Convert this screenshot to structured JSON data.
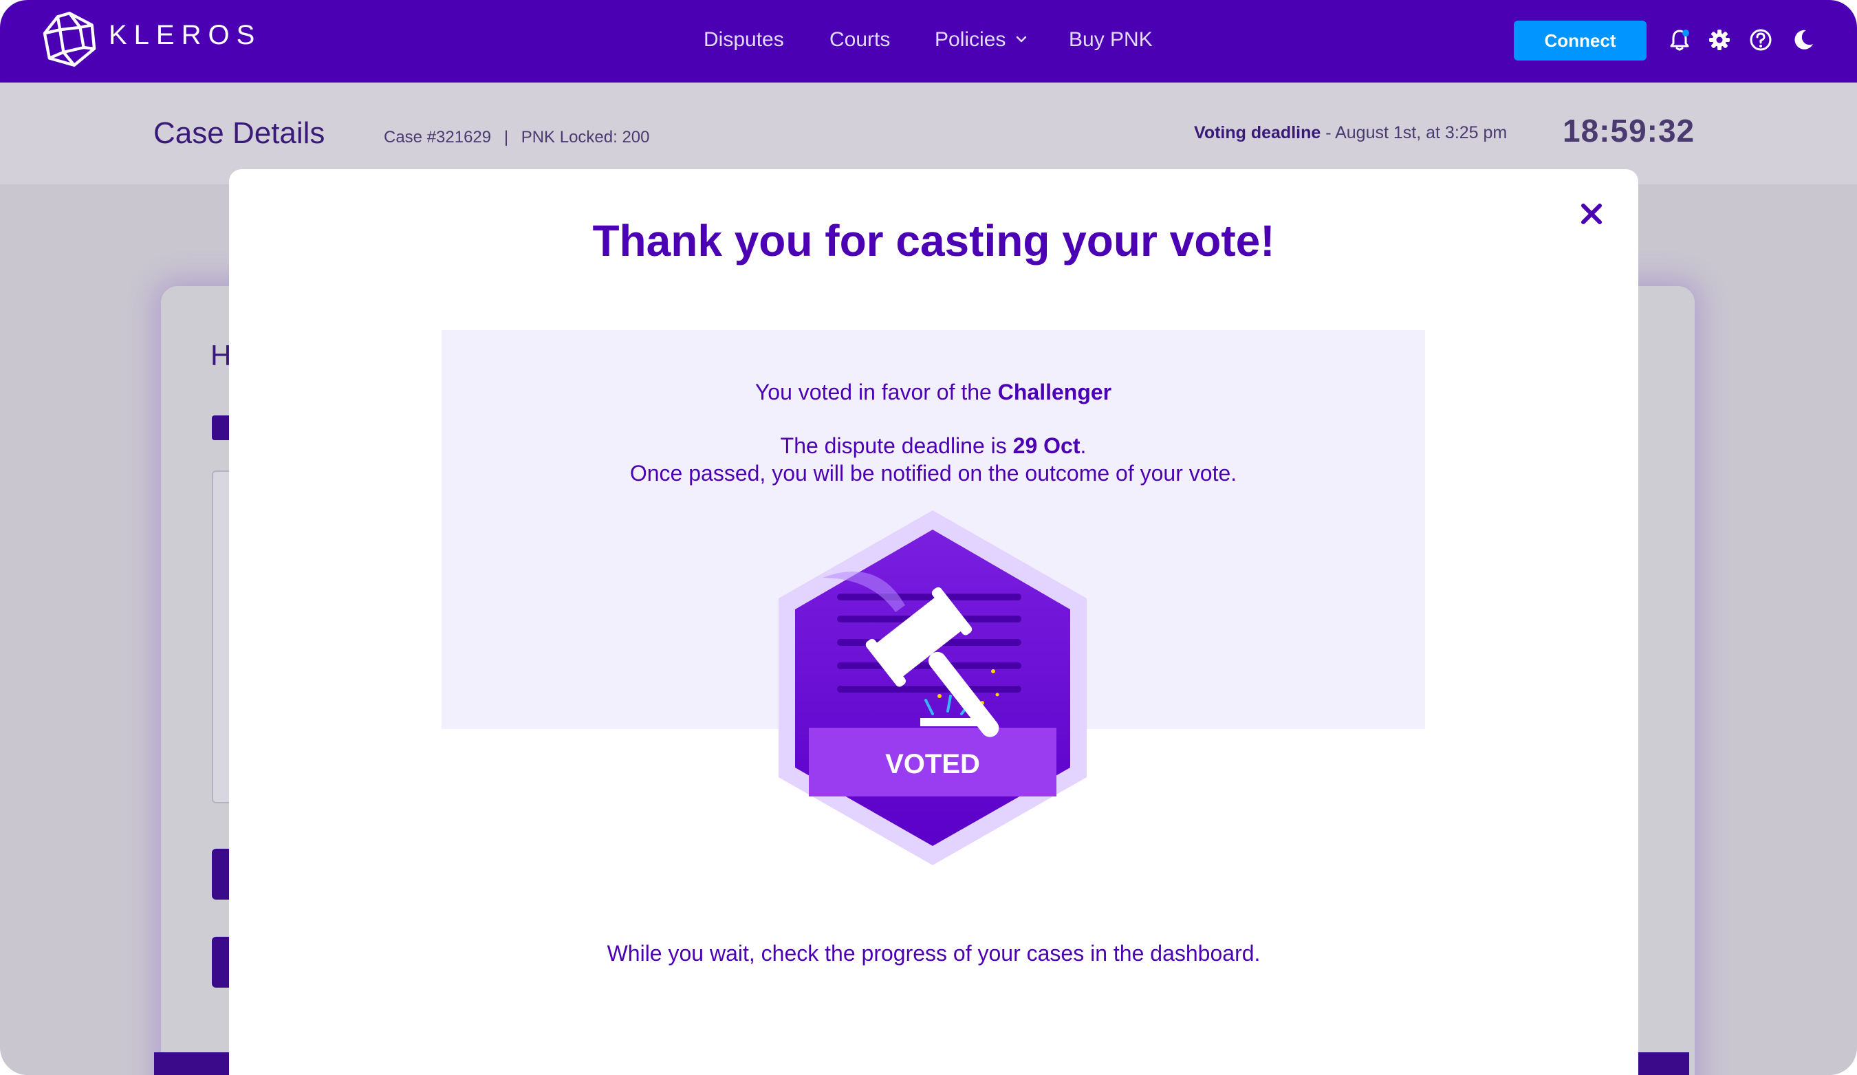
{
  "brand": {
    "name": "KLEROS",
    "primary_color": "#4b00b4",
    "accent_color": "#0095ff"
  },
  "nav": {
    "links": [
      {
        "label": "Disputes"
      },
      {
        "label": "Courts"
      },
      {
        "label": "Policies"
      },
      {
        "label": "Buy PNK"
      }
    ],
    "connect_label": "Connect",
    "icons": [
      "bell-icon",
      "gear-icon",
      "help-icon",
      "moon-icon"
    ]
  },
  "case": {
    "title": "Case Details",
    "case_number": "Case #321629",
    "separator": "|",
    "pnk_locked": "PNK Locked: 200",
    "deadline_label": "Voting deadline",
    "deadline_value": " - August 1st, at 3:25 pm",
    "countdown": "18:59:32"
  },
  "background": {
    "heading_fragment": "H"
  },
  "modal": {
    "title": "Thank you for casting your vote!",
    "voted_prefix": "You voted in favor of the ",
    "voted_party": "Challenger",
    "deadline_prefix": "The dispute deadline is ",
    "deadline_date": "29 Oct",
    "deadline_suffix": ".",
    "notify_text": "Once passed, you will be notified on the outcome of your vote.",
    "badge_label": "VOTED",
    "wait_text": "While you wait, check the progress of your cases in the dashboard."
  }
}
